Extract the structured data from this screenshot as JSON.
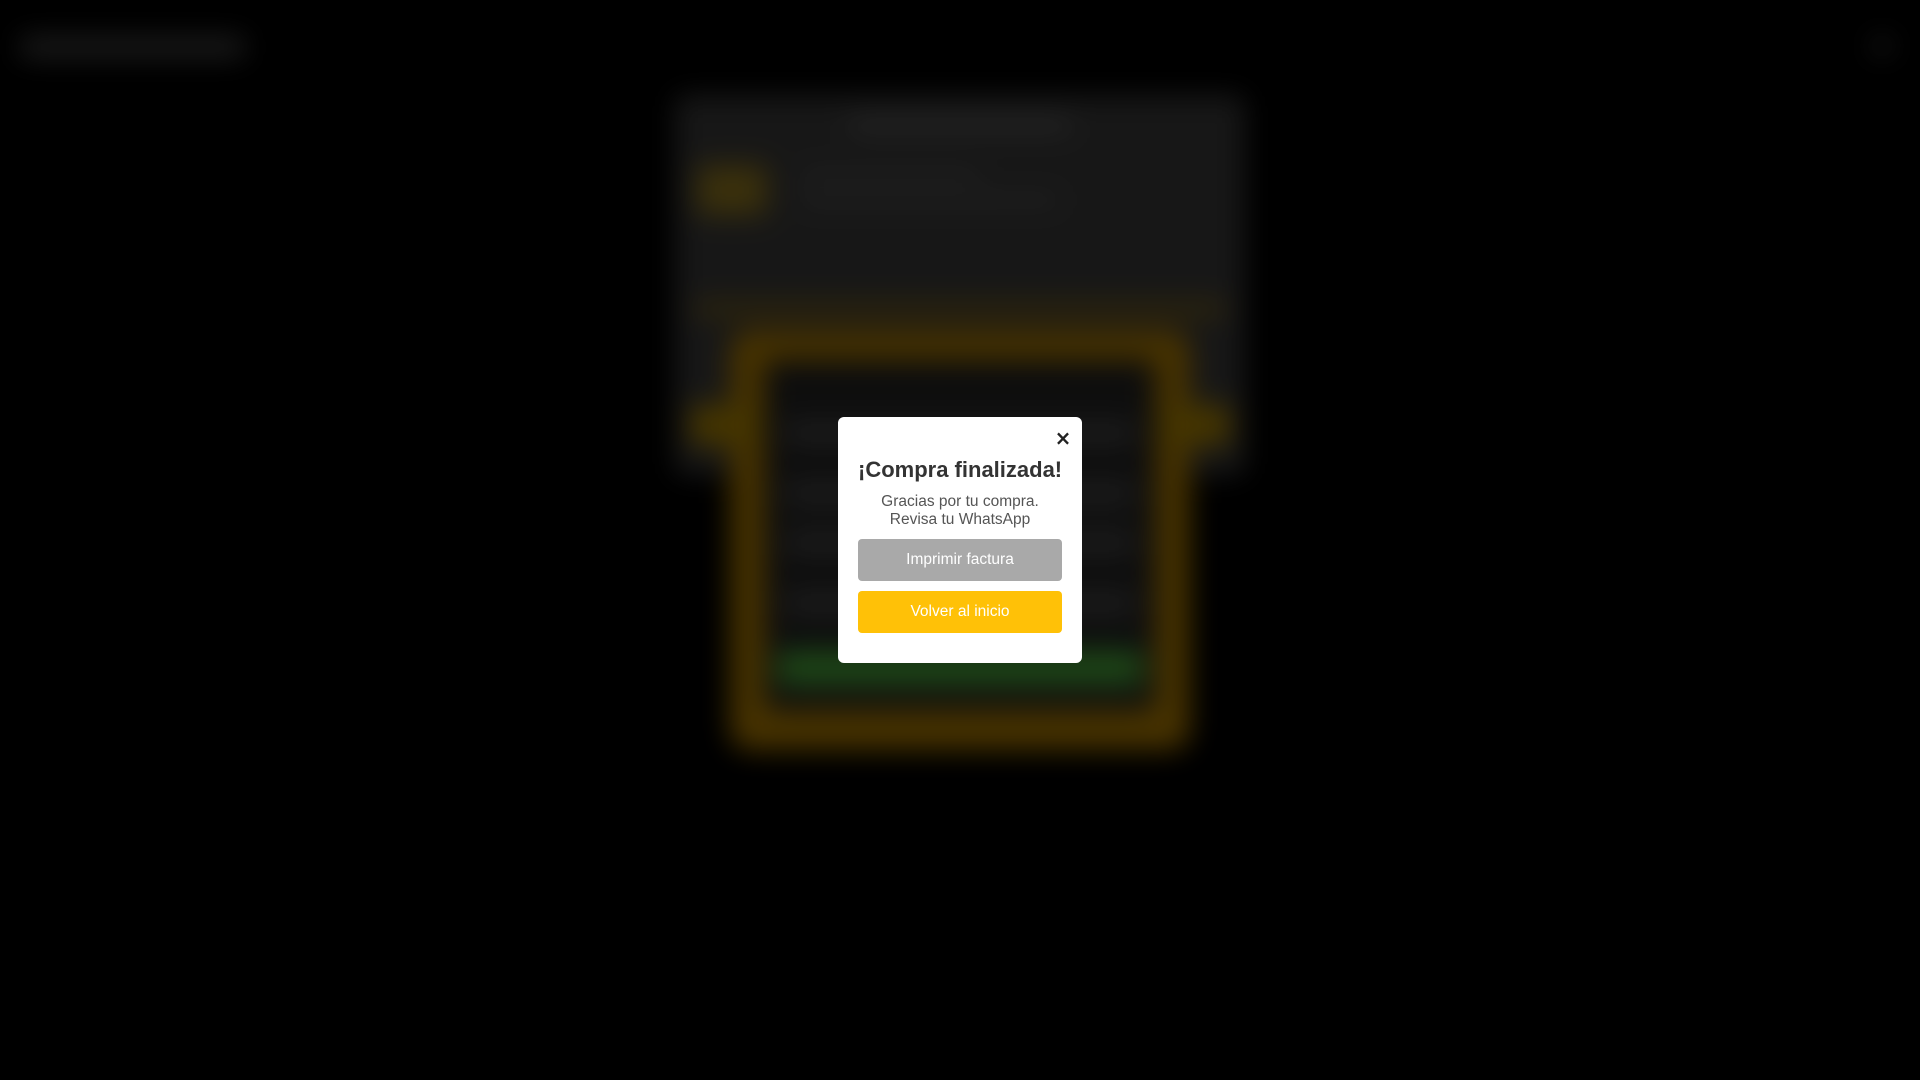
{
  "modal": {
    "close_label": "×",
    "title": "¡Compra finalizada!",
    "message_line1": "Gracias por tu compra.",
    "message_line2": "Revisa tu WhatsApp",
    "print_button": "Imprimir factura",
    "home_button": "Volver al inicio"
  },
  "colors": {
    "print_button_bg": "#a9a9a9",
    "home_button_bg": "#ffc107",
    "backdrop": "#000000"
  },
  "icons": {
    "close": "close-icon"
  }
}
